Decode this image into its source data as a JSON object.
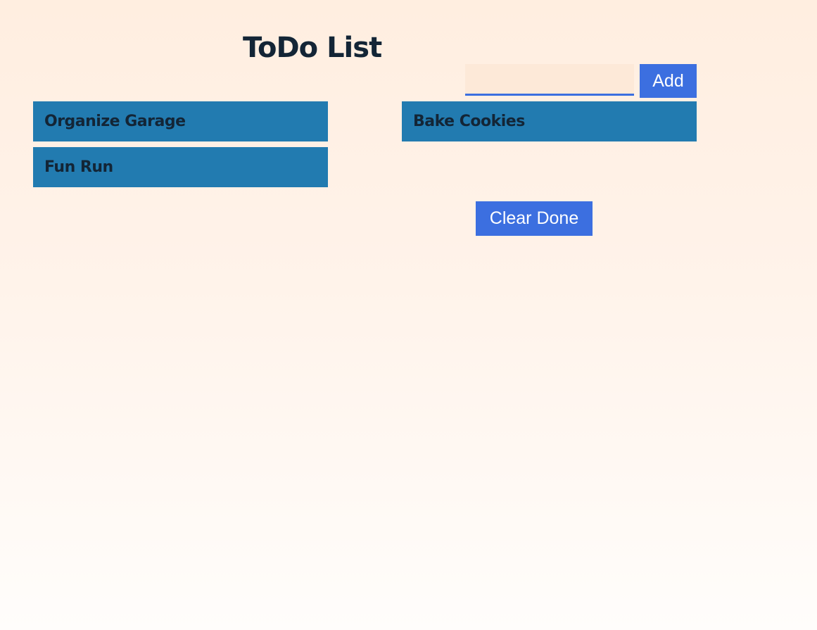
{
  "header": {
    "title": "ToDo List"
  },
  "form": {
    "input_value": "",
    "input_placeholder": "",
    "add_label": "Add"
  },
  "lists": {
    "pending": [
      "Organize Garage",
      "Fun Run"
    ],
    "done": [
      "Bake Cookies"
    ]
  },
  "actions": {
    "clear_done_label": "Clear Done"
  },
  "colors": {
    "accent": "#3c6fe0",
    "item_background": "#227bb0",
    "text": "#132536",
    "page_top": "#ffeee0",
    "page_bottom": "#fffdfb"
  }
}
